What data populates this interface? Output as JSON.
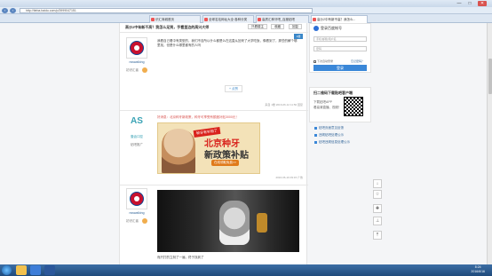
{
  "browser": {
    "url": "http://tieba.baidu.com/p/3999047151",
    "tabs": [
      {
        "label": "识汇商城首页"
      },
      {
        "label": "全球名站网址大全·各种分类"
      },
      {
        "label": "高质汇种牙吧_百度贴吧"
      },
      {
        "label": "高沙2中有新不高？我怎么..."
      }
    ],
    "window_controls": {
      "minimize": "—",
      "maximize": "□",
      "close": "✕"
    }
  },
  "thread": {
    "title": "高沙2中有新不高？我怎么足到，手看里边的高兴大师",
    "buttons": {
      "only_op": "只看楼主",
      "favorite": "收藏",
      "reply": "回复"
    }
  },
  "posts": [
    {
      "author": "rswwalking",
      "level": "初识汇者",
      "floor": "1楼",
      "text": "我看自己看中有类型的，我们不自所以什么都是么在这直从回来了大学吃饭，像看到了，那些的解个哪里找，但是什么哪里都有的人吗",
      "like_label": "点赞",
      "meta": "来自 1楼 2016-06-12 11:50 回复"
    },
    {
      "author": "壹齿口腔",
      "level": "贴吧推广",
      "ad_title": "好消息：北京种牙新政策，种牙可享受有额度补贴3000元！",
      "ad_tag": "种牙有补贴了",
      "ad_line1": "北京种牙",
      "ad_line2": "新政策补贴",
      "ad_cta": "在线领取免费>>",
      "meta": "2016-06-16 09:15 广告"
    },
    {
      "author": "rswwalking",
      "level": "初识汇者",
      "text": "而只打的立刻了一遍，终于找到了"
    }
  ],
  "sidebar": {
    "login_title": "登录百度帐号",
    "username_placeholder": "手机/邮箱/用户名",
    "password_placeholder": "密码",
    "remember_label": "下次自动登录",
    "forgot_label": "忘记密码？",
    "login_button": "登录",
    "app_title": "扫二维码下载贴吧客户端",
    "app_line1": "下载贴吧APP",
    "app_line2": "看高清直播、视频！",
    "links": [
      "贴吧页面意见反馈",
      "违规贴吧处理公示",
      "贴吧违规信息处理公示"
    ]
  },
  "taskbar": {
    "time": "8:24",
    "date": "2016/6/16"
  }
}
